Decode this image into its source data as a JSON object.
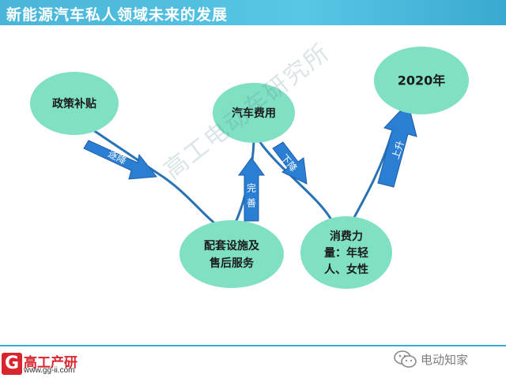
{
  "header": {
    "title": "新能源汽车私人领域未来的发展"
  },
  "nodes": {
    "subsidy": "政策补贴",
    "facilities_line1": "配套设施及",
    "facilities_line2": "售后服务",
    "car_cost": "汽车费用",
    "consumer_line1": "消费力",
    "consumer_line2": "量：年轻",
    "consumer_line3": "人、女性",
    "year": "2020年"
  },
  "arrows": {
    "decrease": "逐降",
    "improve": "完善",
    "fall": "下降",
    "rise": "上升"
  },
  "watermark": "高工电动车研究所",
  "footer": {
    "logo_letter": "G",
    "logo_name": "高工产研",
    "logo_url": "www.gg-ii.com",
    "brand": "电动知家"
  },
  "colors": {
    "node_fill": "#7fe0c4",
    "arrow_fill": "#2a7fd4",
    "line": "#2872b5",
    "header": "#4ab7d9"
  }
}
